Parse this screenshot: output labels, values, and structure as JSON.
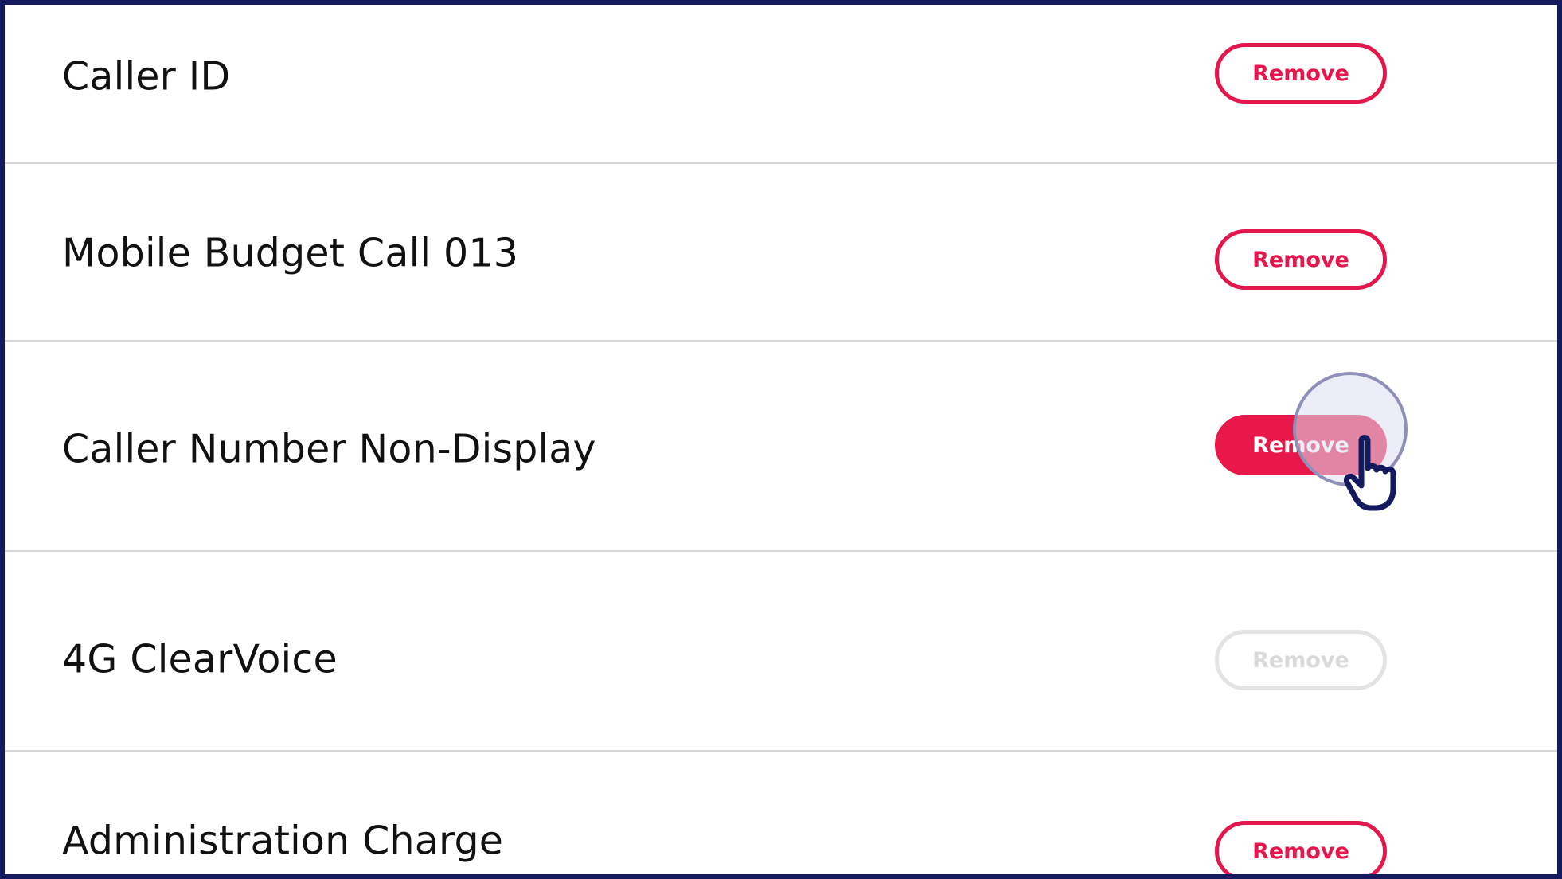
{
  "services": [
    {
      "label": "Caller ID",
      "button_label": "Remove",
      "state": "outlined"
    },
    {
      "label": "Mobile Budget Call 013",
      "button_label": "Remove",
      "state": "outlined"
    },
    {
      "label": "Caller Number Non-Display",
      "button_label": "Remove",
      "state": "filled"
    },
    {
      "label": "4G ClearVoice",
      "button_label": "Remove",
      "state": "disabled"
    },
    {
      "label": "Administration Charge",
      "button_label": "Remove",
      "state": "outlined"
    }
  ],
  "colors": {
    "accent": "#e8194a",
    "frame": "#141a5e",
    "disabled": "#e3e3e3",
    "divider": "#d6d6d6"
  },
  "cursor": {
    "icon": "hand-pointer-icon"
  }
}
